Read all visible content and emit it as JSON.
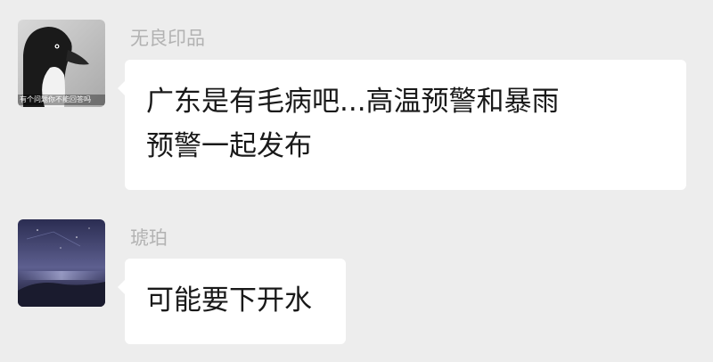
{
  "messages": [
    {
      "sender": "无良印品",
      "text": "广东是有毛病吧...高温预警和暴雨\n预警一起发布",
      "avatar_icon": "penguin-avatar-icon",
      "avatar_caption": "有个问题你不能回答吗"
    },
    {
      "sender": "琥珀",
      "text": "可能要下开水",
      "avatar_icon": "night-sky-avatar-icon"
    }
  ],
  "colors": {
    "background": "#ededed",
    "bubble": "#ffffff",
    "sender_name": "#b2b2b2",
    "message_text": "#191919"
  }
}
